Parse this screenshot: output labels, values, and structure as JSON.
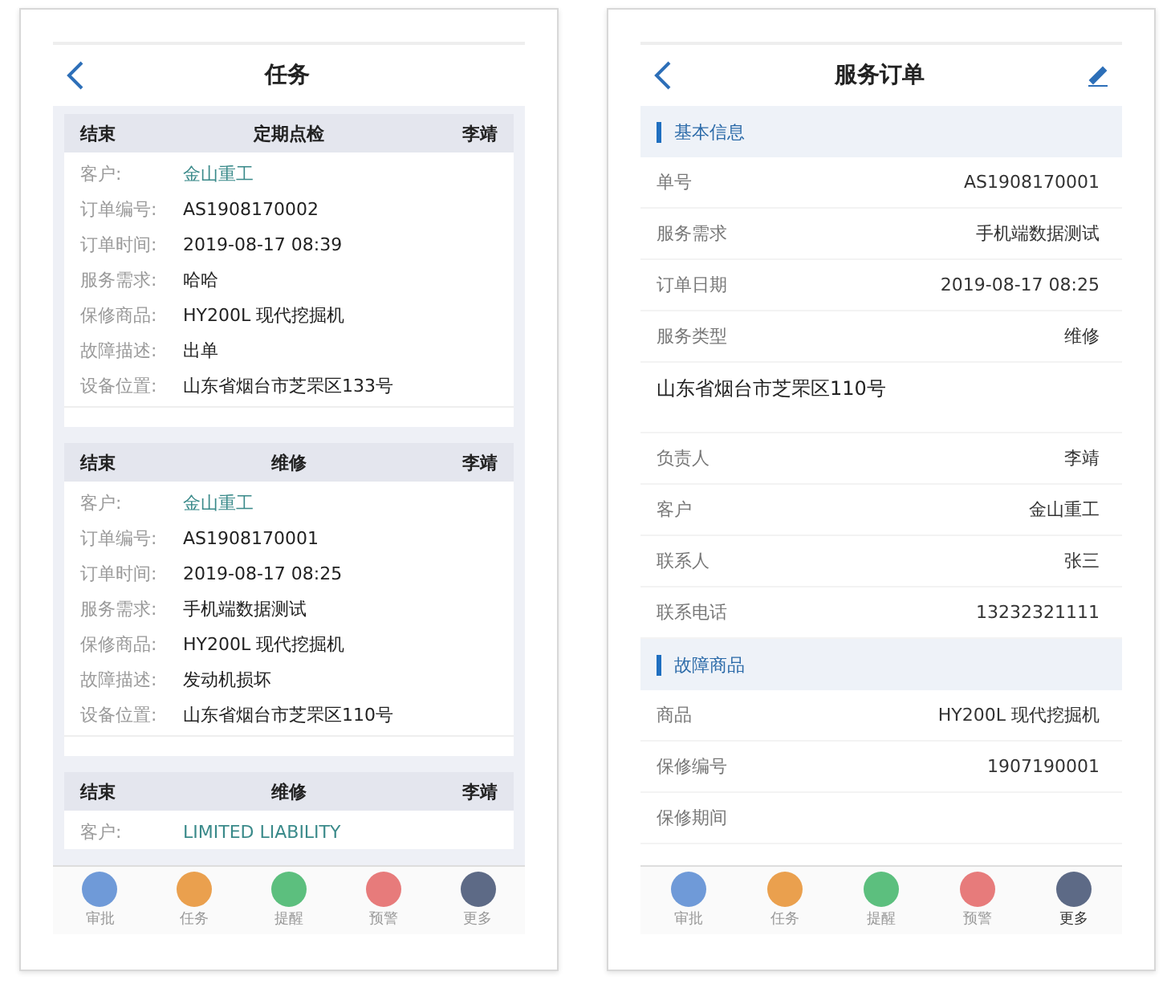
{
  "task_screen": {
    "title": "任务",
    "cards": [
      {
        "status": "结束",
        "type": "定期点检",
        "owner": "李靖",
        "fields": [
          {
            "label": "客户:",
            "value": "金山重工",
            "kind": "link"
          },
          {
            "label": "订单编号:",
            "value": "AS1908170002",
            "kind": "text"
          },
          {
            "label": "订单时间:",
            "value": "2019-08-17 08:39",
            "kind": "text"
          },
          {
            "label": "服务需求:",
            "value": "哈哈",
            "kind": "text"
          },
          {
            "label": "保修商品:",
            "value": "HY200L 现代挖掘机",
            "kind": "text"
          },
          {
            "label": "故障描述:",
            "value": "出单",
            "kind": "text"
          },
          {
            "label": "设备位置:",
            "value": "山东省烟台市芝罘区133号",
            "kind": "text"
          }
        ]
      },
      {
        "status": "结束",
        "type": "维修",
        "owner": "李靖",
        "fields": [
          {
            "label": "客户:",
            "value": "金山重工",
            "kind": "link"
          },
          {
            "label": "订单编号:",
            "value": "AS1908170001",
            "kind": "text"
          },
          {
            "label": "订单时间:",
            "value": "2019-08-17 08:25",
            "kind": "text"
          },
          {
            "label": "服务需求:",
            "value": "手机端数据测试",
            "kind": "text"
          },
          {
            "label": "保修商品:",
            "value": "HY200L 现代挖掘机",
            "kind": "text"
          },
          {
            "label": "故障描述:",
            "value": "发动机损坏",
            "kind": "text"
          },
          {
            "label": "设备位置:",
            "value": "山东省烟台市芝罘区110号",
            "kind": "text"
          }
        ]
      },
      {
        "status": "结束",
        "type": "维修",
        "owner": "李靖",
        "fields": [
          {
            "label": "客户:",
            "value": "LIMITED LIABILITY",
            "kind": "link"
          }
        ]
      }
    ],
    "tab_bar": [
      {
        "label": "审批",
        "color": "#6f9ad8",
        "selected": false
      },
      {
        "label": "任务",
        "color": "#eaa04e",
        "selected": false
      },
      {
        "label": "提醒",
        "color": "#5cbf7e",
        "selected": false
      },
      {
        "label": "预警",
        "color": "#e77b7b",
        "selected": false
      },
      {
        "label": "更多",
        "color": "#5d6a86",
        "selected": false
      }
    ]
  },
  "order_screen": {
    "title": "服务订单",
    "sections": [
      {
        "title": "基本信息",
        "rows": [
          {
            "kind": "pair",
            "label": "单号",
            "value": "AS1908170001"
          },
          {
            "kind": "pair",
            "label": "服务需求",
            "value": "手机端数据测试"
          },
          {
            "kind": "pair",
            "label": "订单日期",
            "value": "2019-08-17 08:25"
          },
          {
            "kind": "pair",
            "label": "服务类型",
            "value": "维修"
          },
          {
            "kind": "address",
            "value": "山东省烟台市芝罘区110号"
          },
          {
            "kind": "pair",
            "label": "负责人",
            "value": "李靖"
          },
          {
            "kind": "pair",
            "label": "客户",
            "value": "金山重工"
          },
          {
            "kind": "pair",
            "label": "联系人",
            "value": "张三"
          },
          {
            "kind": "pair",
            "label": "联系电话",
            "value": "13232321111"
          }
        ]
      },
      {
        "title": "故障商品",
        "rows": [
          {
            "kind": "pair",
            "label": "商品",
            "value": "HY200L 现代挖掘机"
          },
          {
            "kind": "pair",
            "label": "保修编号",
            "value": "1907190001"
          },
          {
            "kind": "pair",
            "label": "保修期间"
          }
        ]
      }
    ],
    "tab_bar": [
      {
        "label": "审批",
        "color": "#6f9ad8",
        "selected": false
      },
      {
        "label": "任务",
        "color": "#eaa04e",
        "selected": false
      },
      {
        "label": "提醒",
        "color": "#5cbf7e",
        "selected": false
      },
      {
        "label": "预警",
        "color": "#e77b7b",
        "selected": false
      },
      {
        "label": "更多",
        "color": "#5d6a86",
        "selected": true
      }
    ]
  }
}
